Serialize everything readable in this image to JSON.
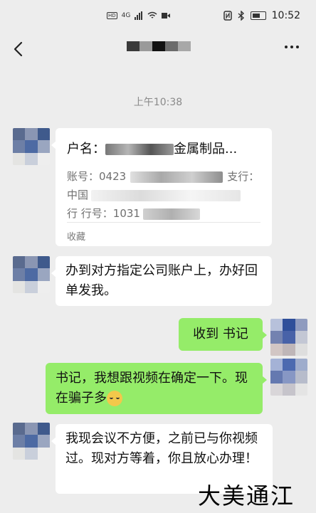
{
  "statusbar": {
    "hd_label": "HD",
    "network_label": "4G",
    "time": "10:52"
  },
  "navbar": {
    "back_icon": "chevron-left-icon",
    "more_icon": "more-dots-icon"
  },
  "timestamp": "上午10:38",
  "messages": [
    {
      "type": "account-card",
      "title_label": "户名：",
      "title_suffix": "金属制品...",
      "account_label": "账号：",
      "account_partial": "0423",
      "branch_label": "支行：",
      "bank_partial": "中国",
      "bank_code_label": "行 行号：",
      "bank_code_partial": "1031",
      "footer": "收藏"
    },
    {
      "type": "text-in",
      "text": "办到对方指定公司账户上，办好回单发我。"
    },
    {
      "type": "text-out",
      "text": "收到 书记"
    },
    {
      "type": "text-out",
      "text": "书记，我想跟视频在确定一下。现在骗子多"
    },
    {
      "type": "text-in",
      "text": "我现会议不方便，之前已与你视频过。现对方等着，你且放心办理！"
    }
  ],
  "watermark": "大美通江",
  "colors": {
    "background": "#ededed",
    "bubble_in": "#ffffff",
    "bubble_out": "#95ec69"
  }
}
